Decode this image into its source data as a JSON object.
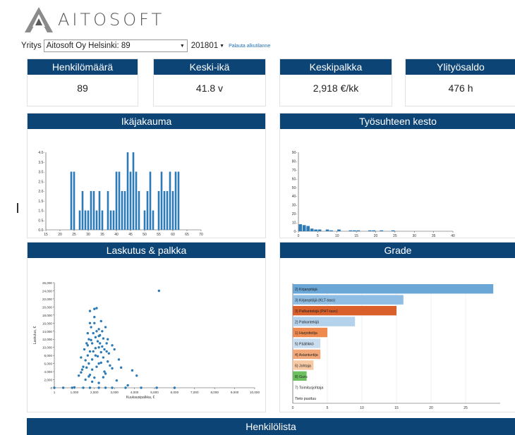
{
  "brand": {
    "name": "AITOSOFT"
  },
  "selector": {
    "company_label": "Yritys",
    "company_value": "Aitosoft Oy Helsinki: 89",
    "period_value": "201801",
    "reset_link": "Palauta alkutilanne"
  },
  "kpis": [
    {
      "title": "Henkilömäärä",
      "value": "89"
    },
    {
      "title": "Keski-ikä",
      "value": "41.8 v"
    },
    {
      "title": "Keskipalkka",
      "value": "2,918 €/kk"
    },
    {
      "title": "Ylityösaldo",
      "value": "476 h"
    }
  ],
  "charts": {
    "age": {
      "title": "Ikäjakauma"
    },
    "tenure": {
      "title": "Työsuhteen kesto"
    },
    "billing": {
      "title": "Laskutus & palkka"
    },
    "grade": {
      "title": "Grade"
    }
  },
  "employee_list": {
    "title": "Henkilölista"
  },
  "chart_data": [
    {
      "type": "bar",
      "title": "Ikäjakauma",
      "xlim": [
        15,
        70
      ],
      "ylim": [
        0,
        4
      ],
      "xticks": [
        "15",
        "20",
        "25",
        "30",
        "35",
        "40",
        "45",
        "50",
        "55",
        "60",
        "65",
        "70"
      ],
      "yticks": [
        "0.0-",
        "0.5-",
        "1.0-",
        "1.5-",
        "2.0-",
        "2.5-",
        "3.0-",
        "3.5-",
        "4.0-"
      ],
      "x": [
        24,
        25,
        27,
        28,
        29,
        30,
        31,
        32,
        33,
        34,
        35,
        37,
        38,
        39,
        40,
        41,
        42,
        43,
        44,
        45,
        46,
        47,
        48,
        50,
        51,
        52,
        53,
        55,
        56,
        57,
        58,
        59,
        60,
        61,
        62
      ],
      "values": [
        3,
        3,
        1,
        2,
        1,
        1,
        2,
        2,
        1,
        2,
        1,
        2,
        1,
        1,
        3,
        3,
        2,
        2,
        4,
        3,
        4,
        3,
        2,
        1,
        2,
        3,
        1,
        2,
        3,
        2,
        2,
        3,
        2,
        3,
        3
      ]
    },
    {
      "type": "bar",
      "title": "Työsuhteen kesto",
      "xlim": [
        0,
        40
      ],
      "ylim": [
        0,
        90
      ],
      "xticks": [
        "0",
        "5",
        "10",
        "15",
        "20",
        "25",
        "30",
        "35",
        "40"
      ],
      "yticks": [
        "0-",
        "10-",
        "20-",
        "30-",
        "40-",
        "50-",
        "60-",
        "70-",
        "80-",
        "90-"
      ],
      "x": [
        0.5,
        1.5,
        2.5,
        3.5,
        4.5,
        5.5,
        7.5,
        8.5,
        10.5,
        13.5,
        14.5,
        15.5,
        18.5,
        19.5,
        21.5,
        24.5
      ],
      "values": [
        8,
        7,
        6,
        3,
        2,
        2,
        2,
        1,
        2,
        1,
        1,
        1,
        1,
        1,
        1,
        1
      ]
    },
    {
      "type": "scatter",
      "title": "Laskutus & palkka",
      "xlabel": "Kuukausipalkka, €",
      "ylabel": "Laskutus, €",
      "xlim": [
        1000,
        10000
      ],
      "ylim": [
        0,
        26000
      ],
      "xticks": [
        "1",
        "1,000",
        "2,000",
        "3,000",
        "4,000",
        "5,000",
        "6,000",
        "7,000",
        "8,000",
        "9,000",
        "10,000"
      ],
      "yticks": [
        "0",
        "2,000",
        "4,000",
        "6,000",
        "8,000",
        "10,000",
        "12,000",
        "14,000",
        "16,000",
        "18,000",
        "20,000",
        "22,000",
        "24,000",
        "26,000"
      ],
      "points": [
        [
          1000,
          0
        ],
        [
          1400,
          0
        ],
        [
          1800,
          0
        ],
        [
          1900,
          100
        ],
        [
          2300,
          0
        ],
        [
          2600,
          0
        ],
        [
          3000,
          0
        ],
        [
          3300,
          0
        ],
        [
          3600,
          0
        ],
        [
          4200,
          0
        ],
        [
          4900,
          0
        ],
        [
          5600,
          0
        ],
        [
          6400,
          0
        ],
        [
          2100,
          3000
        ],
        [
          2200,
          3800
        ],
        [
          2250,
          4500
        ],
        [
          2300,
          5200
        ],
        [
          2400,
          6800
        ],
        [
          2450,
          5000
        ],
        [
          2500,
          8000
        ],
        [
          2500,
          10500
        ],
        [
          2550,
          12000
        ],
        [
          2600,
          9000
        ],
        [
          2600,
          19000
        ],
        [
          2650,
          15000
        ],
        [
          2700,
          11000
        ],
        [
          2700,
          7000
        ],
        [
          2750,
          13500
        ],
        [
          2800,
          19500
        ],
        [
          2800,
          16000
        ],
        [
          2850,
          12500
        ],
        [
          2850,
          9800
        ],
        [
          2900,
          19700
        ],
        [
          2900,
          14000
        ],
        [
          2950,
          11500
        ],
        [
          3000,
          10000
        ],
        [
          3000,
          6000
        ],
        [
          3050,
          13000
        ],
        [
          3100,
          8800
        ],
        [
          3100,
          16500
        ],
        [
          3150,
          10200
        ],
        [
          3200,
          12200
        ],
        [
          3200,
          7500
        ],
        [
          3250,
          9500
        ],
        [
          3300,
          15000
        ],
        [
          3350,
          11000
        ],
        [
          3400,
          6500
        ],
        [
          3450,
          8500
        ],
        [
          3500,
          5500
        ],
        [
          3600,
          4800
        ],
        [
          3700,
          9500
        ],
        [
          3900,
          7000
        ],
        [
          4000,
          5000
        ],
        [
          4500,
          4300
        ],
        [
          4700,
          3000
        ],
        [
          2400,
          2000
        ],
        [
          2600,
          3200
        ],
        [
          2700,
          1500
        ],
        [
          2800,
          2500
        ],
        [
          3000,
          1200
        ],
        [
          3200,
          2600
        ],
        [
          5700,
          24000
        ],
        [
          2200,
          7500
        ],
        [
          2350,
          9500
        ],
        [
          2550,
          6000
        ],
        [
          2650,
          11800
        ],
        [
          2750,
          9000
        ],
        [
          2950,
          7800
        ],
        [
          3050,
          11000
        ],
        [
          3150,
          14000
        ],
        [
          3350,
          9000
        ],
        [
          2500,
          13500
        ],
        [
          2700,
          4500
        ],
        [
          2850,
          8000
        ],
        [
          3000,
          12800
        ],
        [
          3100,
          6200
        ],
        [
          3250,
          4000
        ],
        [
          2450,
          11000
        ],
        [
          2900,
          5200
        ],
        [
          3400,
          12000
        ],
        [
          3600,
          10500
        ],
        [
          2600,
          16000
        ],
        [
          2800,
          17500
        ],
        [
          3000,
          14500
        ],
        [
          2550,
          2800
        ],
        [
          3300,
          3500
        ],
        [
          3800,
          1800
        ],
        [
          4300,
          600
        ]
      ]
    },
    {
      "type": "bar",
      "title": "Grade",
      "orientation": "horizontal",
      "xlim": [
        0,
        30
      ],
      "xticks": [
        "0",
        "5",
        "10",
        "15",
        "20",
        "25"
      ],
      "categories": [
        "2) Kirjanpitäjä",
        "3) Kirjanpitäjä (KLT-taso)",
        "3) Palkantekijä (PHT-taso)",
        "2) Palkantekijä",
        "1) Harjoittelija",
        "5) Päällikkö",
        "4) Asiantuntija",
        "6) Johtaja",
        "8) Guru",
        "7) Toimitusjohtaja",
        "Tieto puuttuu"
      ],
      "values": [
        29,
        16,
        15,
        9,
        5,
        4,
        4,
        3,
        2,
        0,
        0
      ],
      "colors": [
        "#6aa6d6",
        "#8fbde3",
        "#d95f2b",
        "#b5d2ec",
        "#ee8a4f",
        "#c9ddf0",
        "#f2a878",
        "#f7c9a4",
        "#6cbf5f",
        "#ffffff",
        "#ffffff"
      ]
    }
  ]
}
